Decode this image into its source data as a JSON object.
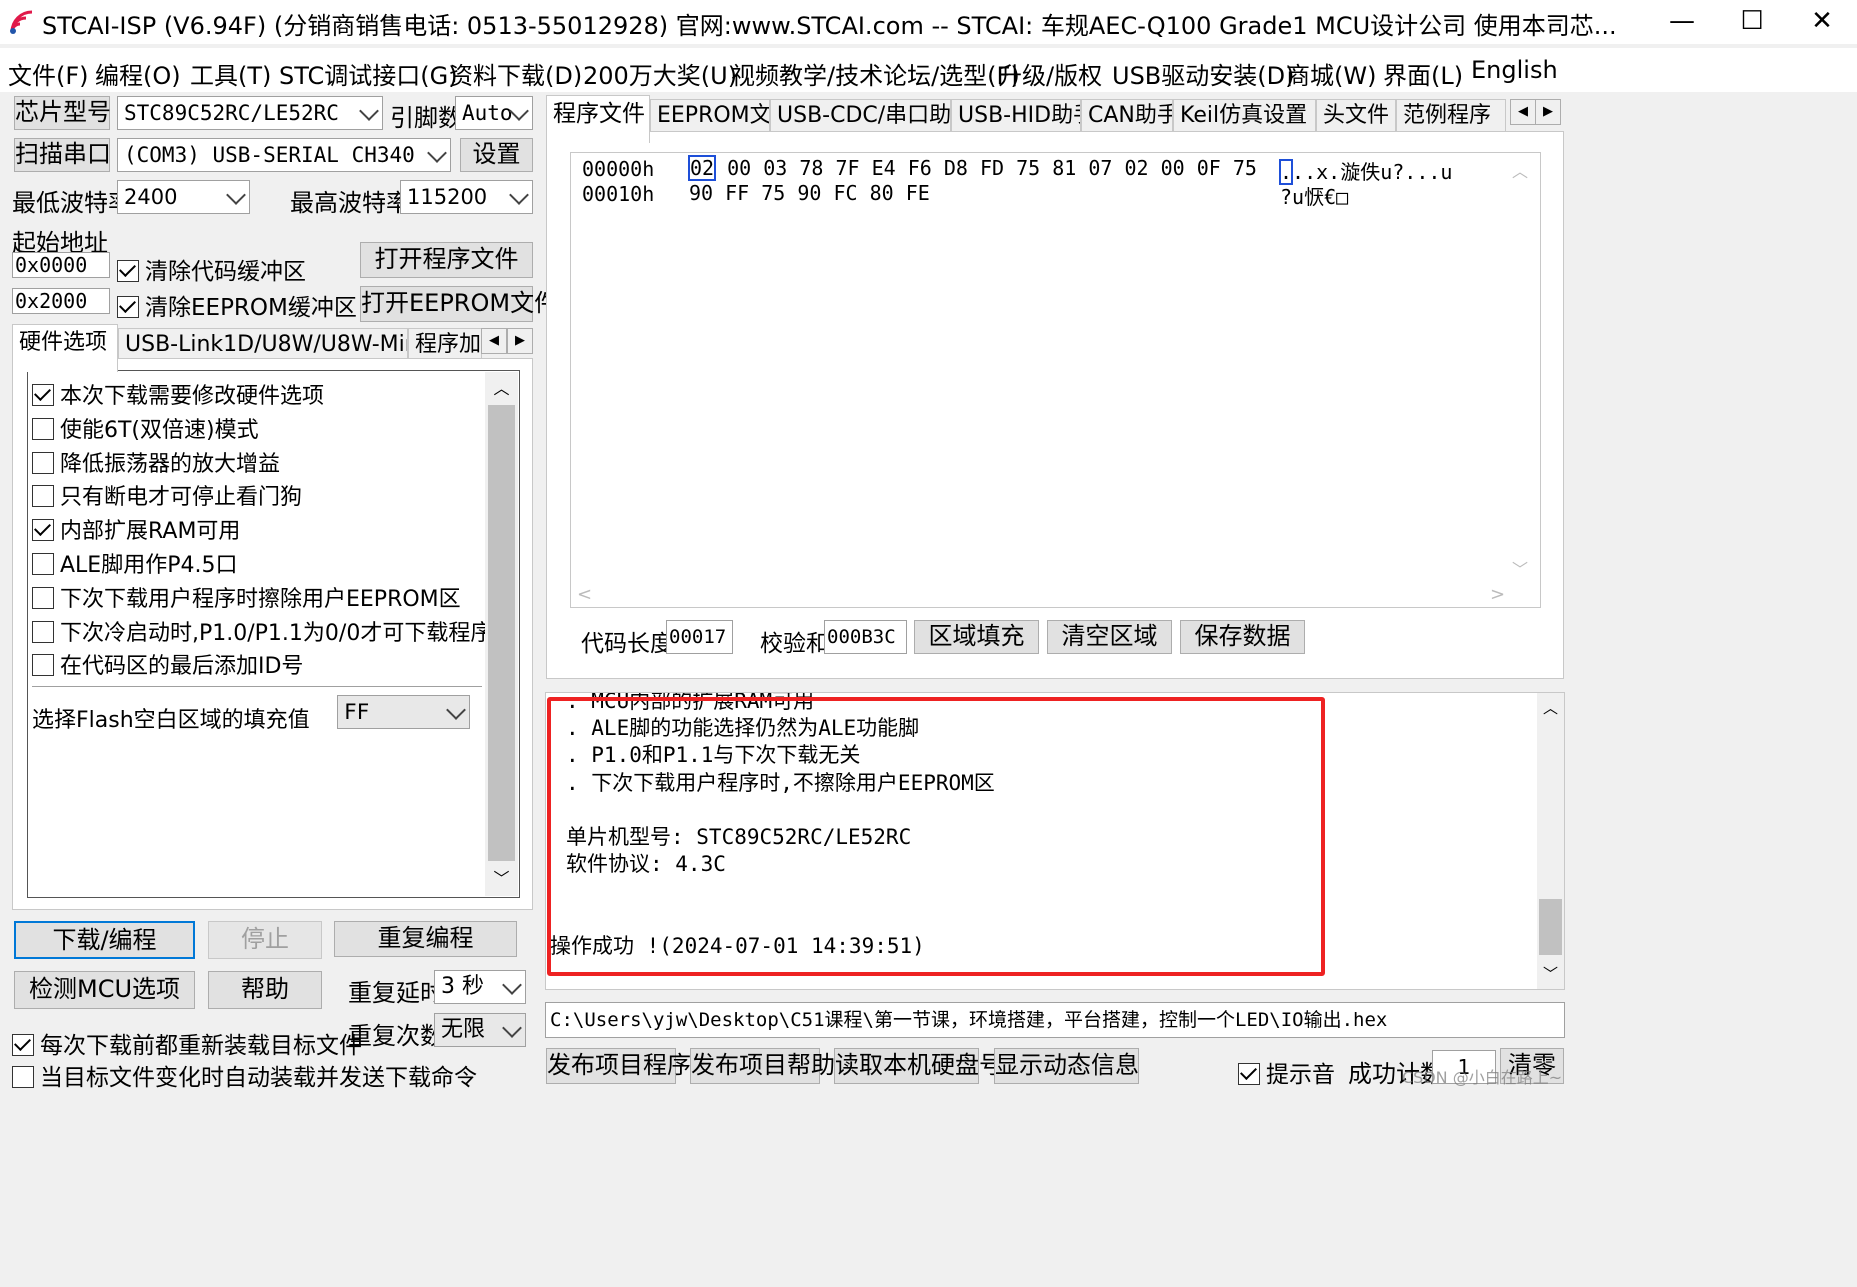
{
  "titlebar": {
    "title": "STCAI-ISP (V6.94F) (分销商销售电话: 0513-55012928) 官网:www.STCAI.com  -- STCAI: 车规AEC-Q100 Grade1 MCU设计公司 使用本司芯...",
    "minimize": "—",
    "maximize": "☐",
    "close": "✕"
  },
  "menu": [
    "文件(F)",
    "编程(O)",
    "工具(T)",
    "STC调试接口(G)",
    "资料下载(D)",
    "200万大奖(U)",
    "视频教学/技术论坛/选型(F)",
    "升级/版权",
    "USB驱动安装(D)",
    "商城(W)",
    "界面(L)",
    "English"
  ],
  "left": {
    "chip_label": "芯片型号",
    "chip_value": "STC89C52RC/LE52RC",
    "pins_label": "引脚数",
    "pins_value": "Auto",
    "scan_label": "扫描串口",
    "port_value": "(COM3) USB-SERIAL CH340",
    "settings_label": "设置",
    "min_baud_label": "最低波特率",
    "min_baud_value": "2400",
    "max_baud_label": "最高波特率",
    "max_baud_value": "115200",
    "start_addr_label": "起始地址",
    "addr1": "0x0000",
    "addr2": "0x2000",
    "clear_code": "清除代码缓冲区",
    "clear_eeprom": "清除EEPROM缓冲区",
    "open_program": "打开程序文件",
    "open_eeprom": "打开EEPROM文件",
    "tabs": [
      "硬件选项",
      "USB-Link1D/U8W/U8W-Mini脱机",
      "程序加"
    ],
    "options": [
      {
        "label": "本次下载需要修改硬件选项",
        "checked": true
      },
      {
        "label": "使能6T(双倍速)模式",
        "checked": false
      },
      {
        "label": "降低振荡器的放大增益",
        "checked": false
      },
      {
        "label": "只有断电才可停止看门狗",
        "checked": false
      },
      {
        "label": "内部扩展RAM可用",
        "checked": true
      },
      {
        "label": "ALE脚用作P4.5口",
        "checked": false
      },
      {
        "label": "下次下载用户程序时擦除用户EEPROM区",
        "checked": false
      },
      {
        "label": "下次冷启动时,P1.0/P1.1为0/0才可下载程序",
        "checked": false
      },
      {
        "label": "在代码区的最后添加ID号",
        "checked": false
      }
    ],
    "fill_label": "选择Flash空白区域的填充值",
    "fill_value": "FF",
    "download_btn": "下载/编程",
    "stop_btn": "停止",
    "reprogram_btn": "重复编程",
    "detect_btn": "检测MCU选项",
    "help_btn": "帮助",
    "repeat_delay_label": "重复延时",
    "repeat_delay_value": "3 秒",
    "repeat_count_label": "重复次数",
    "repeat_count_value": "无限",
    "reload_check": "每次下载前都重新装载目标文件",
    "auto_check": "当目标文件变化时自动装载并发送下载命令"
  },
  "right": {
    "tabs": [
      "程序文件",
      "EEPROM文件",
      "USB-CDC/串口助手",
      "USB-HID助手",
      "CAN助手",
      "Keil仿真设置",
      "头文件",
      "范例程序"
    ],
    "hex_rows": [
      {
        "addr": "00000h",
        "bytes": "02 00 03 78 7F E4 F6 D8 FD 75 81 07 02 00 0F 75",
        "ascii": "...x.漩佚u?...u",
        "first": "02",
        "rest": " 00 03 78 7F E4 F6 D8 FD 75 81 07 02 00 0F 75",
        "ascii_first": ".",
        "ascii_rest": "..x.漩佚u?...u"
      },
      {
        "addr": "00010h",
        "bytes": "90 FF 75 90 FC 80 FE",
        "ascii": "?u恹€□"
      }
    ],
    "code_len_label": "代码长度",
    "code_len_value": "00017",
    "checksum_label": "校验和",
    "checksum_value": "000B3C",
    "fill_btn": "区域填充",
    "clear_btn": "清空区域",
    "save_btn": "保存数据",
    "log": [
      ". MCU内部的扩展RAM可用",
      ". ALE脚的功能选择仍然为ALE功能脚",
      ". P1.0和P1.1与下次下载无关",
      ". 下次下载用户程序时,不擦除用户EEPROM区",
      "",
      "单片机型号: STC89C52RC/LE52RC",
      "软件协议: 4.3C",
      "",
      "",
      "操作成功 !(2024-07-01 14:39:51)"
    ],
    "path": "C:\\Users\\yjw\\Desktop\\C51课程\\第一节课，环境搭建，平台搭建，控制一个LED\\IO输出.hex",
    "publish_btn": "发布项目程序",
    "publish_help_btn": "发布项目帮助",
    "read_disk_btn": "读取本机硬盘号",
    "show_info_btn": "显示动态信息",
    "tip_check": "提示音",
    "success_label": "成功计数",
    "success_value": "1",
    "clear_count_btn": "清零",
    "watermark": "CSDN @小白在路上~"
  }
}
